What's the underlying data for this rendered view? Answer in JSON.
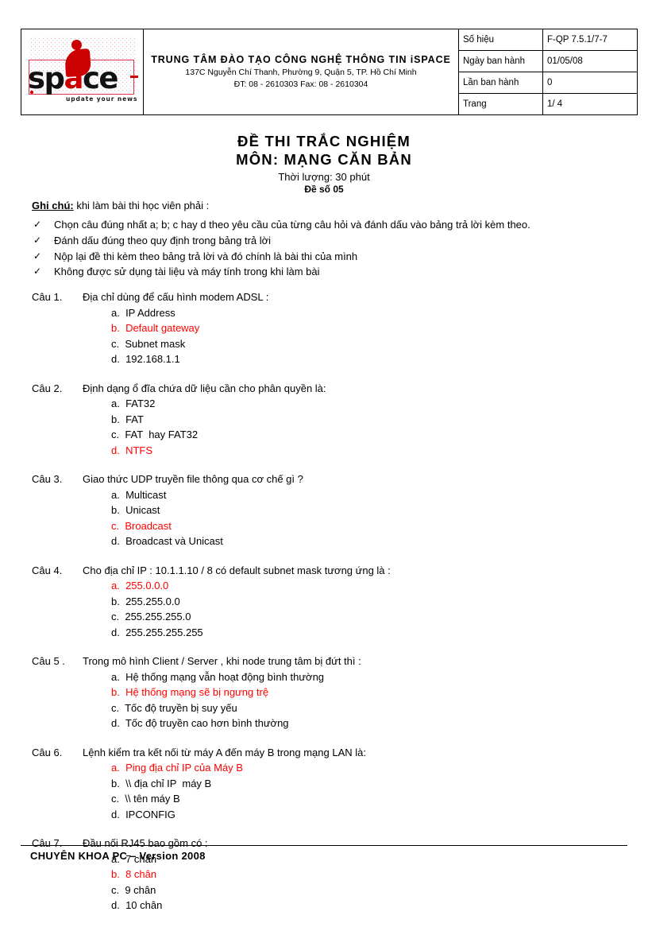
{
  "header": {
    "logo": {
      "wordmark_sp": "sp",
      "wordmark_a": "a",
      "wordmark_ce": "ce",
      "tagline": "update your news"
    },
    "org_name": "TRUNG  TÂM ĐÀO TẠO CÔNG NGHỆ THÔNG TIN iSPACE",
    "org_address": "137C Nguyễn Chí Thanh, Phường 9, Quận 5, TP. Hồ Chí Minh",
    "org_phone": "ĐT: 08 - 2610303     Fax: 08 - 2610304",
    "meta_rows": [
      {
        "label": "Số hiệu",
        "value": "F-QP 7.5.1/7-7"
      },
      {
        "label": "Ngày ban hành",
        "value": "01/05/08"
      },
      {
        "label": "Lần ban hành",
        "value": "0"
      },
      {
        "label": "Trang",
        "value": "1/ 4"
      }
    ]
  },
  "title": {
    "line1": "ĐỀ THI  TRẮC NGHIỆM",
    "line2": "MÔN: MẠNG  CĂN  BẢN",
    "duration": "Thời lượng: 30 phút",
    "code": "Đề số 05"
  },
  "notes": {
    "label": "Ghi chú:",
    "intro": " khi làm bài thi học viên phải :",
    "check_glyph": "✓",
    "items": [
      "Chọn câu đúng nhất a; b;  c hay d theo yêu cầu của từng câu hỏi và đánh dấu vào bảng trả lời kèm theo.",
      "Đánh dấu đúng theo quy định trong bảng trả lời",
      "Nộp lại đề thi kèm theo bảng trả lời và đó chính là bài thi của mình",
      "Không được sử dụng tài liệu và máy tính trong khi làm bài"
    ]
  },
  "questions": [
    {
      "number": "Câu 1.",
      "prompt": "Địa chỉ dùng để cấu hình modem ADSL :",
      "options": [
        {
          "text": "a.  IP Address",
          "answer": false
        },
        {
          "text": "b.  Default gateway",
          "answer": true
        },
        {
          "text": "c.  Subnet mask",
          "answer": false
        },
        {
          "text": "d.  192.168.1.1",
          "answer": false
        }
      ]
    },
    {
      "number": "Câu 2.",
      "prompt": "Định dạng ổ đĩa  chứa dữ liệu cần cho phân quyền là:",
      "options": [
        {
          "text": "a.  FAT32",
          "answer": false
        },
        {
          "text": "b.  FAT",
          "answer": false
        },
        {
          "text": "c.  FAT  hay FAT32",
          "answer": false
        },
        {
          "text": "d.  NTFS",
          "answer": true
        }
      ]
    },
    {
      "number": "Câu 3.",
      "prompt": "Giao thức UDP truyền file thông qua cơ chế gì ?",
      "options": [
        {
          "text": "a.  Multicast",
          "answer": false
        },
        {
          "text": "b.  Unicast",
          "answer": false
        },
        {
          "text": "c.  Broadcast",
          "answer": true
        },
        {
          "text": "d.  Broadcast và Unicast",
          "answer": false
        }
      ]
    },
    {
      "number": "Câu 4.",
      "prompt": "Cho địa chỉ IP :  10.1.1.10 / 8 có default  subnet mask tương ứng là :",
      "options": [
        {
          "text": "a.  255.0.0.0",
          "answer": true
        },
        {
          "text": "b.  255.255.0.0",
          "answer": false
        },
        {
          "text": "c.  255.255.255.0",
          "answer": false
        },
        {
          "text": "d.  255.255.255.255",
          "answer": false
        }
      ]
    },
    {
      "number": "Câu 5 .",
      "prompt": "Trong mô hình Client / Server , khi node trung tâm bị đứt thì :",
      "options": [
        {
          "text": "a.  Hệ thống mạng vẫn hoạt động bình thường",
          "answer": false
        },
        {
          "text": "b.  Hệ thống mạng sẽ bị ngưng trệ",
          "answer": true
        },
        {
          "text": "c.  Tốc độ truyền bị suy yếu",
          "answer": false
        },
        {
          "text": "d.  Tốc độ truyền cao hơn bình thường",
          "answer": false
        }
      ]
    },
    {
      "number": "Câu 6.",
      "prompt": "Lệnh kiểm tra kết nối từ máy A đến máy B trong mạng LAN là:",
      "options": [
        {
          "text": "a.  Ping địa chỉ IP của Máy B",
          "answer": true
        },
        {
          "text": "b.  \\\\ địa chỉ IP  máy B",
          "answer": false
        },
        {
          "text": "c.  \\\\ tên máy B",
          "answer": false
        },
        {
          "text": "d.  IPCONFIG",
          "answer": false
        }
      ]
    },
    {
      "number": "Câu 7.",
      "prompt": "Đầu nối RJ45 bao gồm có :",
      "options": [
        {
          "text": "a.  7 chân",
          "answer": false
        },
        {
          "text": "b.  8 chân",
          "answer": true
        },
        {
          "text": "c.  9 chân",
          "answer": false
        },
        {
          "text": "d.  10 chân",
          "answer": false
        }
      ]
    }
  ],
  "footer": {
    "text": "CHUYÊN KHOA PC – Version 2008"
  },
  "colors": {
    "answer_red": "#ff0000",
    "logo_red": "#cc0000",
    "text": "#000000"
  }
}
